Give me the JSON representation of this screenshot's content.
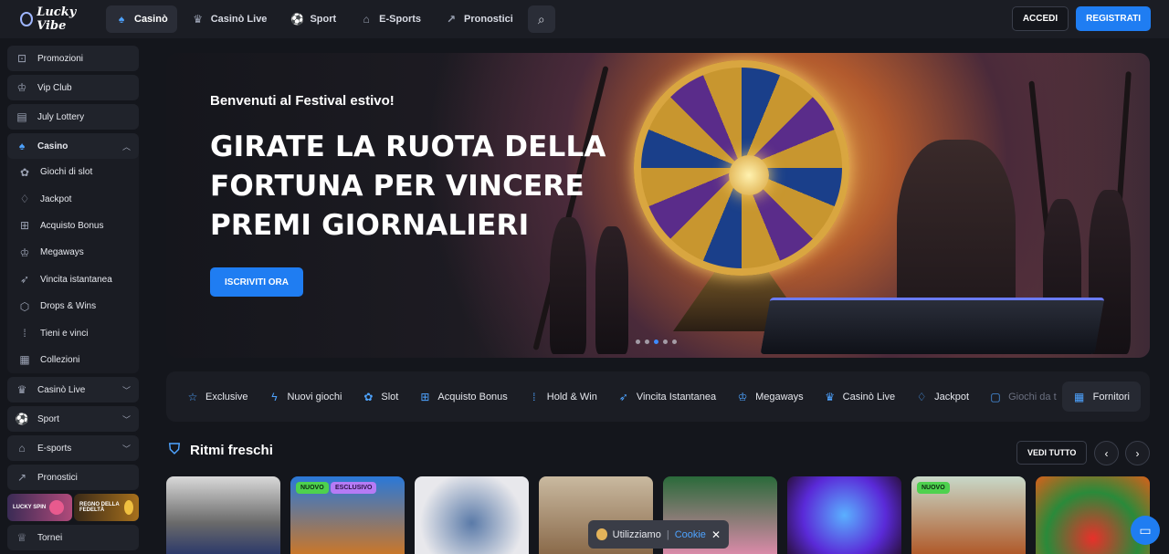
{
  "brand": {
    "logo_text": "Lucky Vibe"
  },
  "topnav": {
    "items": [
      {
        "label": "Casinò",
        "icon": "spade-icon",
        "active": true
      },
      {
        "label": "Casinò Live",
        "icon": "dealer-icon"
      },
      {
        "label": "Sport",
        "icon": "soccer-ball-icon"
      },
      {
        "label": "E-Sports",
        "icon": "gamepad-icon"
      },
      {
        "label": "Pronostici",
        "icon": "chart-icon"
      }
    ],
    "search_icon": "search-icon"
  },
  "auth": {
    "login_label": "ACCEDI",
    "register_label": "REGISTRATI"
  },
  "sidebar": {
    "items_top": [
      {
        "label": "Promozioni",
        "icon": "gift-icon"
      },
      {
        "label": "Vip Club",
        "icon": "crown-icon"
      },
      {
        "label": "July Lottery",
        "icon": "ticket-icon"
      }
    ],
    "casino": {
      "label": "Casino",
      "icon": "spade-icon",
      "expanded": true,
      "subitems": [
        {
          "label": "Giochi di slot",
          "icon": "cherry-icon"
        },
        {
          "label": "Jackpot",
          "icon": "money-bag-icon"
        },
        {
          "label": "Acquisto Bonus",
          "icon": "cart-icon"
        },
        {
          "label": "Megaways",
          "icon": "crown-icon"
        },
        {
          "label": "Vincita istantanea",
          "icon": "rocket-icon"
        },
        {
          "label": "Drops & Wins",
          "icon": "drop-icon"
        },
        {
          "label": "Tieni e vinci",
          "icon": "grid-dots-icon"
        },
        {
          "label": "Collezioni",
          "icon": "grid-icon"
        }
      ]
    },
    "items_bottom": [
      {
        "label": "Casinò Live",
        "icon": "dealer-icon",
        "has_chevron": true
      },
      {
        "label": "Sport",
        "icon": "soccer-ball-icon",
        "has_chevron": true
      },
      {
        "label": "E-sports",
        "icon": "gamepad-icon",
        "has_chevron": true
      },
      {
        "label": "Pronostici",
        "icon": "chart-icon",
        "has_chevron": false
      }
    ],
    "promos": {
      "lucky_spin": "LUCKY SPIN",
      "loyalty": "REGNO DELLA FEDELTÀ"
    },
    "cut_item": "Tornei"
  },
  "hero": {
    "subtitle": "Benvenuti al Festival estivo!",
    "title_lines": [
      "GIRATE LA RUOTA DELLA",
      "FORTUNA PER VINCERE",
      "PREMI GIORNALIERI"
    ],
    "cta_label": "ISCRIVITI ORA",
    "slides_total": 5,
    "active_slide": 3
  },
  "categories": {
    "items": [
      {
        "label": "Exclusive",
        "icon": "star-icon"
      },
      {
        "label": "Nuovi giochi",
        "icon": "lightning-icon"
      },
      {
        "label": "Slot",
        "icon": "cherry-icon"
      },
      {
        "label": "Acquisto Bonus",
        "icon": "cart-icon"
      },
      {
        "label": "Hold & Win",
        "icon": "grid-dots-icon"
      },
      {
        "label": "Vincita Istantanea",
        "icon": "rocket-icon"
      },
      {
        "label": "Megaways",
        "icon": "crown-icon"
      },
      {
        "label": "Casinò Live",
        "icon": "dealer-icon"
      },
      {
        "label": "Jackpot",
        "icon": "money-bag-icon"
      },
      {
        "label": "Giochi da t",
        "icon": "cards-icon"
      }
    ],
    "providers_label": "Fornitori"
  },
  "section": {
    "title": "Ritmi freschi",
    "see_all_label": "VEDI TUTTO",
    "games": [
      {
        "tags": []
      },
      {
        "tags": [
          "NUOVO",
          "ESCLUSIVO"
        ]
      },
      {
        "tags": []
      },
      {
        "tags": []
      },
      {
        "tags": []
      },
      {
        "tags": []
      },
      {
        "tags": [
          "NUOVO"
        ]
      },
      {
        "tags": []
      }
    ]
  },
  "cookie": {
    "text": "Utilizziamo",
    "link": "Cookie",
    "close": "✕"
  },
  "colors": {
    "accent": "#1f7df2",
    "bg": "#14161c",
    "panel": "#1b1d24",
    "new_tag": "#4ed14e",
    "exclusive_tag": "#b57bf5"
  }
}
